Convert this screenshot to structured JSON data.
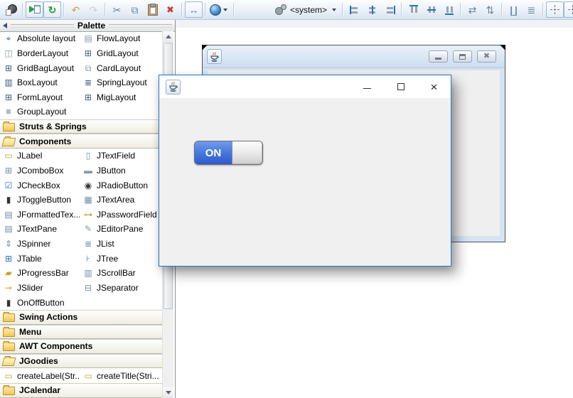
{
  "toolbar": {
    "laf_value": "<system>",
    "groups": [
      {
        "buttons": [
          {
            "name": "parse-button",
            "icon": "parse-icon"
          }
        ]
      },
      {
        "buttons": [
          {
            "name": "test-window-button",
            "icon": "test-icon",
            "framed": true
          },
          {
            "name": "refresh-button",
            "icon": "refresh-icon",
            "glyph": "↻",
            "tone": "green",
            "framed": true
          }
        ]
      },
      {
        "buttons": [
          {
            "name": "undo-button",
            "icon": "undo-icon",
            "glyph": "↶",
            "tone": "gold"
          },
          {
            "name": "redo-button",
            "icon": "redo-icon",
            "glyph": "↷",
            "tone": "disabled"
          }
        ]
      },
      {
        "buttons": [
          {
            "name": "cut-button",
            "icon": "cut-icon",
            "glyph": "✂",
            "tone": "steel"
          },
          {
            "name": "copy-button",
            "icon": "copy-icon",
            "glyph": "⧉",
            "tone": "steel"
          },
          {
            "name": "paste-button",
            "icon": "paste-icon"
          },
          {
            "name": "delete-button",
            "icon": "delete-icon",
            "glyph": "✖",
            "tone": "red"
          }
        ]
      },
      {
        "buttons": [
          {
            "name": "externalize-strings-button",
            "icon": "window-resize-icon",
            "glyph": "↔",
            "tone": "steel",
            "framed": true
          }
        ]
      },
      {
        "buttons": [
          {
            "name": "locale-selector",
            "icon": "globe-icon",
            "dropdown": true
          }
        ]
      },
      {
        "gap": true,
        "buttons": [
          {
            "name": "laf-selector",
            "icon": "gears-icon",
            "text": "<system>",
            "dropdown": true
          }
        ]
      },
      {
        "buttons": [
          {
            "name": "align-left-button",
            "icon": "align-left-icon"
          },
          {
            "name": "align-center-h-button",
            "icon": "align-center-h-icon"
          },
          {
            "name": "align-right-button",
            "icon": "align-right-icon"
          }
        ]
      },
      {
        "buttons": [
          {
            "name": "align-top-button",
            "icon": "align-top-icon"
          },
          {
            "name": "align-middle-button",
            "icon": "align-middle-icon"
          },
          {
            "name": "align-bottom-button",
            "icon": "align-bottom-icon"
          }
        ]
      },
      {
        "buttons": [
          {
            "name": "distribute-h-button",
            "icon": "distribute-h-icon",
            "glyph": "⇄",
            "tone": "steel"
          },
          {
            "name": "distribute-v-button",
            "icon": "distribute-v-icon",
            "glyph": "⇅",
            "tone": "steel"
          }
        ]
      },
      {
        "buttons": [
          {
            "name": "match-width-button",
            "icon": "match-width-icon",
            "glyph": "∐",
            "tone": "steel"
          },
          {
            "name": "match-height-button",
            "icon": "match-height-icon",
            "glyph": "≣",
            "tone": "steel"
          }
        ]
      },
      {
        "buttons": [
          {
            "name": "center-h-in-window-button",
            "icon": "center-h-icon",
            "framed": true
          },
          {
            "name": "center-v-in-window-button",
            "icon": "center-v-icon",
            "framed": true
          }
        ]
      }
    ]
  },
  "palette": {
    "title": "Palette",
    "rows": [
      {
        "kind": "items",
        "cells": [
          {
            "label": "Absolute layout",
            "icon": "absolute-layout-icon",
            "glyph": "⌖",
            "tone": "dark"
          },
          {
            "label": "FlowLayout",
            "icon": "flow-layout-icon",
            "glyph": "▤",
            "tone": "gray"
          }
        ]
      },
      {
        "kind": "items",
        "cells": [
          {
            "label": "BorderLayout",
            "icon": "border-layout-icon",
            "glyph": "◫",
            "tone": "gray"
          },
          {
            "label": "GridLayout",
            "icon": "grid-layout-icon",
            "glyph": "⊞",
            "tone": "dark"
          }
        ]
      },
      {
        "kind": "items",
        "cells": [
          {
            "label": "GridBagLayout",
            "icon": "gridbag-layout-icon",
            "glyph": "⊞",
            "tone": "dark"
          },
          {
            "label": "CardLayout",
            "icon": "card-layout-icon",
            "glyph": "⧉",
            "tone": "gray"
          }
        ]
      },
      {
        "kind": "items",
        "cells": [
          {
            "label": "BoxLayout",
            "icon": "box-layout-icon",
            "glyph": "▥",
            "tone": "dark"
          },
          {
            "label": "SpringLayout",
            "icon": "spring-layout-icon",
            "glyph": "≣",
            "tone": "dark"
          }
        ]
      },
      {
        "kind": "items",
        "cells": [
          {
            "label": "FormLayout",
            "icon": "form-layout-icon",
            "glyph": "⊞",
            "tone": "dark"
          },
          {
            "label": "MigLayout",
            "icon": "mig-layout-icon",
            "glyph": "⊞",
            "tone": "dark"
          }
        ]
      },
      {
        "kind": "items",
        "cells": [
          {
            "label": "GroupLayout",
            "icon": "group-layout-icon",
            "glyph": "≡",
            "tone": "dark"
          }
        ]
      },
      {
        "kind": "category",
        "label": "Struts & Springs",
        "open": false
      },
      {
        "kind": "category",
        "label": "Components",
        "open": true
      },
      {
        "kind": "items",
        "cells": [
          {
            "label": "JLabel",
            "icon": "jlabel-icon",
            "glyph": "▭",
            "tone": "gold"
          },
          {
            "label": "JTextField",
            "icon": "jtextfield-icon",
            "glyph": "▯",
            "tone": "steel"
          }
        ]
      },
      {
        "kind": "items",
        "cells": [
          {
            "label": "JComboBox",
            "icon": "jcombobox-icon",
            "glyph": "⊞",
            "tone": "steel"
          },
          {
            "label": "JButton",
            "icon": "jbutton-icon",
            "glyph": "▬",
            "tone": "gray"
          }
        ]
      },
      {
        "kind": "items",
        "cells": [
          {
            "label": "JCheckBox",
            "icon": "jcheckbox-icon",
            "glyph": "☑",
            "tone": "blue"
          },
          {
            "label": "JRadioButton",
            "icon": "jradiobutton-icon",
            "glyph": "◉",
            "tone": "dark2"
          }
        ]
      },
      {
        "kind": "items",
        "cells": [
          {
            "label": "JToggleButton",
            "icon": "jtogglebutton-icon",
            "glyph": "▮",
            "tone": "dark2"
          },
          {
            "label": "JTextArea",
            "icon": "jtextarea-icon",
            "glyph": "▦",
            "tone": "steel"
          }
        ]
      },
      {
        "kind": "items",
        "cells": [
          {
            "label": "JFormattedTex...",
            "icon": "jformattedtextfield-icon",
            "glyph": "▤",
            "tone": "steel"
          },
          {
            "label": "JPasswordField",
            "icon": "jpasswordfield-icon",
            "glyph": "⊶",
            "tone": "gold"
          }
        ]
      },
      {
        "kind": "items",
        "cells": [
          {
            "label": "JTextPane",
            "icon": "jtextpane-icon",
            "glyph": "▤",
            "tone": "steel"
          },
          {
            "label": "JEditorPane",
            "icon": "jeditorpane-icon",
            "glyph": "✎",
            "tone": "gray"
          }
        ]
      },
      {
        "kind": "items",
        "cells": [
          {
            "label": "JSpinner",
            "icon": "jspinner-icon",
            "glyph": "⇕",
            "tone": "steel"
          },
          {
            "label": "JList",
            "icon": "jlist-icon",
            "glyph": "≣",
            "tone": "steel"
          }
        ]
      },
      {
        "kind": "items",
        "cells": [
          {
            "label": "JTable",
            "icon": "jtable-icon",
            "glyph": "⊞",
            "tone": "blue"
          },
          {
            "label": "JTree",
            "icon": "jtree-icon",
            "glyph": "⊦",
            "tone": "steel"
          }
        ]
      },
      {
        "kind": "items",
        "cells": [
          {
            "label": "JProgressBar",
            "icon": "jprogressbar-icon",
            "glyph": "▰",
            "tone": "gold"
          },
          {
            "label": "JScrollBar",
            "icon": "jscrollbar-icon",
            "glyph": "▥",
            "tone": "steel"
          }
        ]
      },
      {
        "kind": "items",
        "cells": [
          {
            "label": "JSlider",
            "icon": "jslider-icon",
            "glyph": "⊸",
            "tone": "gold"
          },
          {
            "label": "JSeparator",
            "icon": "jseparator-icon",
            "glyph": "⊟",
            "tone": "steel"
          }
        ]
      },
      {
        "kind": "items",
        "cells": [
          {
            "label": "OnOffButton",
            "icon": "onoffbutton-icon",
            "glyph": "▮",
            "tone": "dark2"
          }
        ]
      },
      {
        "kind": "category",
        "label": "Swing Actions",
        "open": false
      },
      {
        "kind": "category",
        "label": "Menu",
        "open": false
      },
      {
        "kind": "category",
        "label": "AWT Components",
        "open": false
      },
      {
        "kind": "category",
        "label": "JGoodies",
        "open": true
      },
      {
        "kind": "items",
        "cells": [
          {
            "label": "createLabel(Str...",
            "icon": "createlabel-icon",
            "glyph": "▭",
            "tone": "gold"
          },
          {
            "label": "createTitle(Stri...",
            "icon": "createtitle-icon",
            "glyph": "▭",
            "tone": "gold"
          }
        ]
      },
      {
        "kind": "category",
        "label": "JCalendar",
        "open": false
      }
    ]
  },
  "design_window": {
    "controls": {
      "close_glyph": "✖"
    }
  },
  "preview_window": {
    "controls": {
      "close_glyph": "×"
    },
    "toggle": {
      "on_label": "ON"
    }
  }
}
